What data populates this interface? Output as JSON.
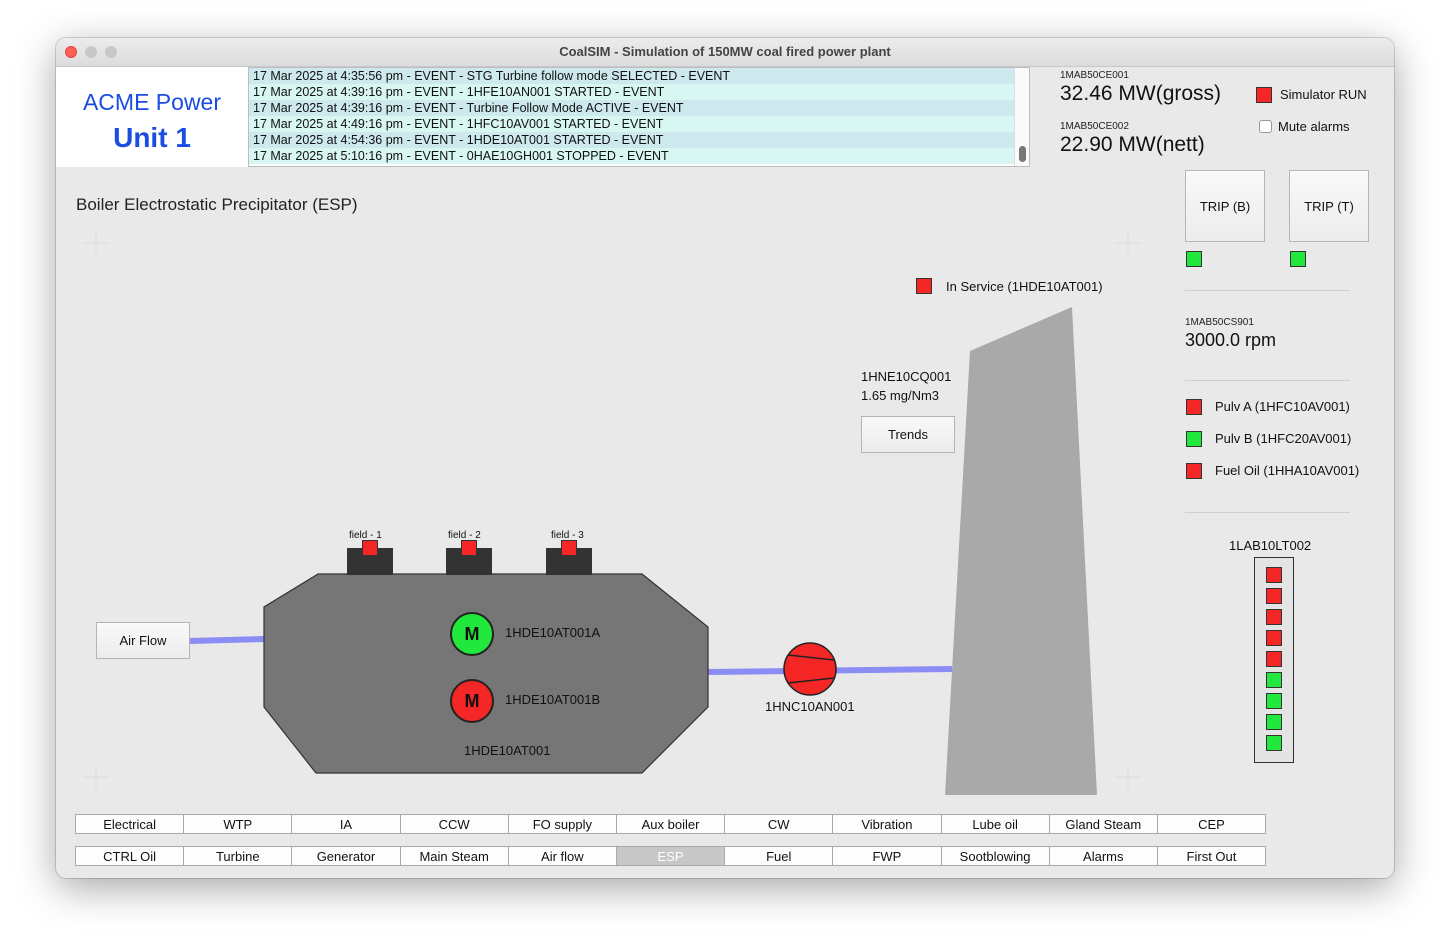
{
  "window": {
    "title": "CoalSIM - Simulation of 150MW coal fired power plant"
  },
  "brand": {
    "company": "ACME Power",
    "unit": "Unit 1"
  },
  "event_log": [
    "17 Mar 2025 at 4:35:56 pm - EVENT - STG Turbine follow mode SELECTED - EVENT",
    "17 Mar 2025 at 4:39:16 pm - EVENT - 1HFE10AN001 STARTED - EVENT",
    "17 Mar 2025 at 4:39:16 pm - EVENT - Turbine Follow Mode ACTIVE - EVENT",
    "17 Mar 2025 at 4:49:16 pm - EVENT - 1HFC10AV001 STARTED - EVENT",
    "17 Mar 2025 at 4:54:36 pm - EVENT - 1HDE10AT001 STARTED - EVENT",
    "17 Mar 2025 at 5:10:16 pm - EVENT - 0HAE10GH001 STOPPED - EVENT"
  ],
  "power": {
    "gross_tag": "1MAB50CE001",
    "gross_value": "32.46 MW(gross)",
    "nett_tag": "1MAB50CE002",
    "nett_value": "22.90 MW(nett)"
  },
  "simulator": {
    "run_label": "Simulator RUN",
    "run_status": "red",
    "mute_label": "Mute alarms",
    "mute_checked": false
  },
  "trip": {
    "boiler_label": "TRIP (B)",
    "boiler_status": "green",
    "turbine_label": "TRIP (T)",
    "turbine_status": "green"
  },
  "speed": {
    "tag": "1MAB50CS901",
    "value": "3000.0 rpm"
  },
  "fuel_sources": [
    {
      "label": "Pulv A (1HFC10AV001)",
      "status": "red"
    },
    {
      "label": "Pulv B (1HFC20AV001)",
      "status": "green"
    },
    {
      "label": "Fuel Oil (1HHA10AV001)",
      "status": "green_off"
    }
  ],
  "level": {
    "tag": "1LAB10LT002",
    "segments": [
      "red",
      "red",
      "red",
      "red",
      "red",
      "green",
      "green",
      "green",
      "green"
    ]
  },
  "page": {
    "title": "Boiler Electrostatic Precipitator (ESP)"
  },
  "esp": {
    "in_service_label": "In Service (1HDE10AT001)",
    "in_service_status": "red",
    "emission_tag": "1HNE10CQ001",
    "emission_value": "1.65 mg/Nm3",
    "trends_label": "Trends",
    "air_flow_label": "Air Flow",
    "fields": [
      {
        "label": "field - 1",
        "status": "red"
      },
      {
        "label": "field - 2",
        "status": "red"
      },
      {
        "label": "field - 3",
        "status": "red"
      }
    ],
    "motor_symbol": "M",
    "motor_a_tag": "1HDE10AT001A",
    "motor_a_status": "green",
    "motor_b_tag": "1HDE10AT001B",
    "motor_b_status": "red",
    "esp_tag": "1HDE10AT001",
    "fan_tag": "1HNC10AN001",
    "fan_status": "red"
  },
  "nav": {
    "row1": [
      "Electrical",
      "WTP",
      "IA",
      "CCW",
      "FO supply",
      "Aux boiler",
      "CW",
      "Vibration",
      "Lube oil",
      "Gland Steam",
      "CEP"
    ],
    "row2": [
      "CTRL Oil",
      "Turbine",
      "Generator",
      "Main Steam",
      "Air flow",
      "ESP",
      "Fuel",
      "FWP",
      "Sootblowing",
      "Alarms",
      "First Out"
    ],
    "active": "ESP"
  },
  "colors": {
    "red": "#f52626",
    "green": "#22e83e",
    "flow": "#8c8cf5",
    "esp_body": "#767676",
    "stack": "#a9a9a9"
  }
}
